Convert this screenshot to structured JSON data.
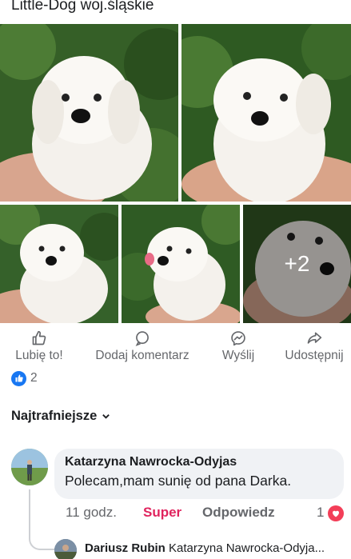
{
  "post": {
    "title": "Little-Dog woj.śląskie",
    "more_photos": "+2"
  },
  "actions": {
    "like": "Lubię to!",
    "comment": "Dodaj komentarz",
    "send": "Wyślij",
    "share": "Udostępnij"
  },
  "reactions": {
    "count": "2"
  },
  "sort": {
    "label": "Najtrafniejsze"
  },
  "comment": {
    "author": "Katarzyna Nawrocka-Odyjas",
    "text": "Polecam,mam sunię od pana Darka.",
    "time": "11 godz.",
    "reaction_label": "Super",
    "reply_label": "Odpowiedz",
    "reaction_count": "1"
  },
  "reply": {
    "author": "Dariusz Rubin",
    "text": "Katarzyna Nawrocka-Odyja..."
  },
  "colors": {
    "accent": "#1877f2",
    "heart": "#f33e58",
    "super": "#e0245e",
    "muted": "#65676b"
  }
}
